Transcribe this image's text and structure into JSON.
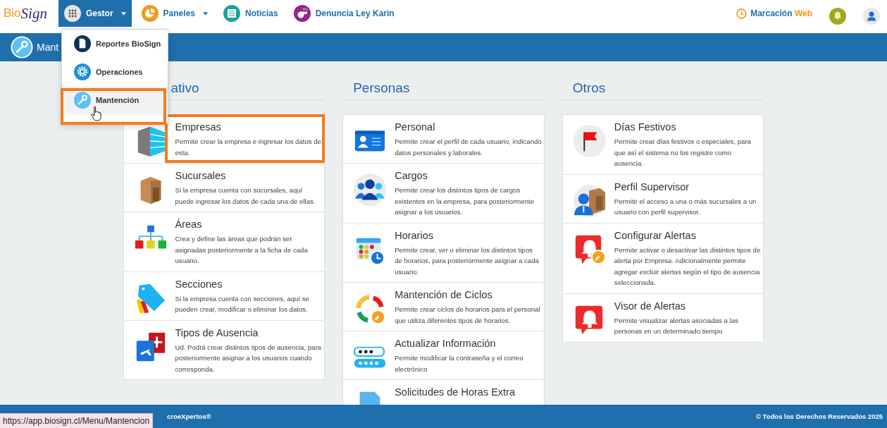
{
  "nav": {
    "logo": {
      "first": "Bio",
      "second": "Sign"
    },
    "items": [
      {
        "label": "Gestor",
        "selected": true,
        "caret": true
      },
      {
        "label": "Paneles",
        "selected": false,
        "caret": true
      },
      {
        "label": "Noticias",
        "selected": false,
        "caret": false
      },
      {
        "label": "Denuncia Ley Karin",
        "selected": false,
        "caret": false
      }
    ],
    "clock_link": {
      "label": "Marcación",
      "accent": "Web"
    }
  },
  "dropdown": {
    "items": [
      {
        "label": "Reportes BioSign",
        "selected": false,
        "highlighted": false
      },
      {
        "label": "Operaciones",
        "selected": false,
        "highlighted": false
      },
      {
        "label": "Mantención",
        "selected": true,
        "highlighted": true
      }
    ]
  },
  "page_header": {
    "title": "Mant"
  },
  "sections": [
    {
      "title": "ativo",
      "items": [
        {
          "title": "Empresas",
          "description": "Permite crear la empresa e ingresar los datos de esta.",
          "highlighted": true
        },
        {
          "title": "Sucursales",
          "description": "Si la empresa cuenta con sucursales, aquí puede ingresar los datos de cada una de ellas.",
          "highlighted": false
        },
        {
          "title": "Áreas",
          "description": "Crea y define las áreas que podrán ser asignadas posteriormente a la ficha de cada usuario.",
          "highlighted": false
        },
        {
          "title": "Secciones",
          "description": "Si la empresa cuenta con secciones, aquí se pueden crear, modificar o eliminar los datos.",
          "highlighted": false
        },
        {
          "title": "Tipos de Ausencia",
          "description": "Ud. Podrá crear distintos tipos de ausencia, para posteriormente asignar a los usuarios cuando corresponda.",
          "highlighted": false
        }
      ]
    },
    {
      "title": "Personas",
      "items": [
        {
          "title": "Personal",
          "description": "Permite crear el perfil de cada usuario, indicando datos personales y laborales.",
          "highlighted": false
        },
        {
          "title": "Cargos",
          "description": "Permite crear los distintos tipos de cargos existentes en la empresa, para posteriormente asignar a los usuarios.",
          "highlighted": false
        },
        {
          "title": "Horarios",
          "description": "Permite crear, ver o eliminar los distintos tipos de horarios, para posteriormente asignar a cada usuario.",
          "highlighted": false
        },
        {
          "title": "Mantención de Ciclos",
          "description": "Permite crear ciclos de horarios para el personal que utiliza diferentes tipos de horarios.",
          "highlighted": false
        },
        {
          "title": "Actualizar Información",
          "description": "Permite modificar la contraseña y el correo electrónico",
          "highlighted": false
        },
        {
          "title": "Solicitudes de Horas Extra",
          "highlighted": false
        }
      ]
    },
    {
      "title": "Otros",
      "items": [
        {
          "title": "Días Festivos",
          "description": "Permite crear días festivos o especiales, para que así el sistema no los registre como ausencia.",
          "highlighted": false
        },
        {
          "title": "Perfil Supervisor",
          "description": "Permitir el acceso a una o más sucursales a un usuario con perfil supervisor.",
          "highlighted": false
        },
        {
          "title": "Configurar Alertas",
          "description": "Permite activar o desactivar las distintos tipos de alerta por Empresa. Adicionalmente permite agregar excluir alertas según el tipo de ausencia seleccionada.",
          "highlighted": false
        },
        {
          "title": "Visor de Alertas",
          "description": "Permite visualizar alertas asociadas a las personas en un determinado tiempo",
          "highlighted": false
        }
      ]
    }
  ],
  "footer": {
    "credit": "croeXpertos®",
    "rights": "© Todos los Derechos Reservados 2025"
  },
  "status_url": "https://app.biosign.cl/Menu/Mantencion"
}
